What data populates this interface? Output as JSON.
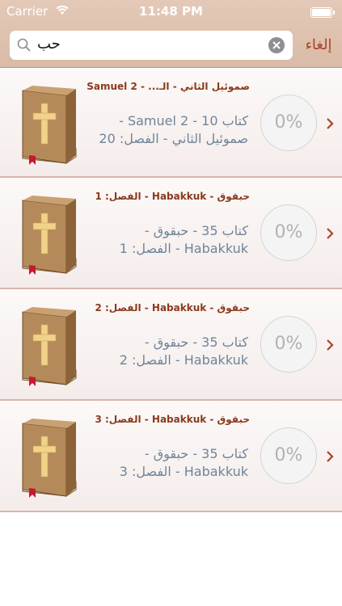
{
  "status_bar": {
    "carrier": "Carrier",
    "time": "11:48 PM"
  },
  "search": {
    "query": "حب",
    "cancel_label": "إلغاء"
  },
  "results": [
    {
      "title": "صموئيل الثاني - الـ... - 2 Samuel",
      "line1": "كتاب 10 - 2 Samuel -",
      "line2": "صموئيل الثاني - الفصل: 20",
      "progress": "0%"
    },
    {
      "title": "حبقوق - Habakkuk - الفصل: 1",
      "line1": "كتاب 35 - حبقوق -",
      "line2": "Habakkuk - الفصل: 1",
      "progress": "0%"
    },
    {
      "title": "حبقوق - Habakkuk - الفصل: 2",
      "line1": "كتاب 35 - حبقوق -",
      "line2": "Habakkuk - الفصل: 2",
      "progress": "0%"
    },
    {
      "title": "حبقوق - Habakkuk - الفصل: 3",
      "line1": "كتاب 35 - حبقوق -",
      "line2": "Habakkuk - الفصل: 3",
      "progress": "0%"
    }
  ],
  "colors": {
    "header": "#dcc0ad",
    "accent": "#a8442a",
    "title": "#8a3a1d",
    "subtitle": "#6f8499"
  }
}
